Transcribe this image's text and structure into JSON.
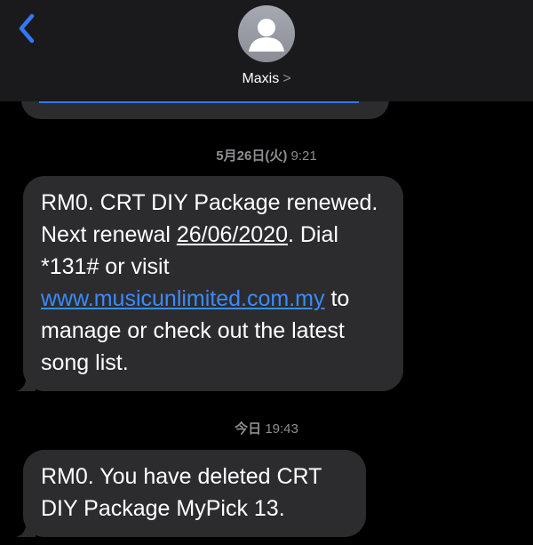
{
  "header": {
    "contact_name": "Maxis",
    "contact_chevron": ">",
    "back_icon": "chevron-left-icon",
    "avatar_icon": "person-silhouette-icon",
    "accent_color": "#3478f6"
  },
  "messages": [
    {
      "timestamp_date": "5月26日(火)",
      "timestamp_time": "9:21",
      "text_before_date": "RM0. CRT DIY Package renewed. Next renewal ",
      "date_link": "26/06/2020",
      "text_mid": ". Dial *131# or visit ",
      "url_link": "www.musicunlimited.com.my",
      "text_after": " to manage or check out the latest song list."
    },
    {
      "timestamp_date": "今日",
      "timestamp_time": "19:43",
      "text": "RM0. You have deleted CRT DIY Package MyPick 13."
    }
  ],
  "colors": {
    "background": "#000000",
    "bubble": "#2c2c2e",
    "link": "#3a8bff",
    "timestamp": "#8e8e93"
  }
}
